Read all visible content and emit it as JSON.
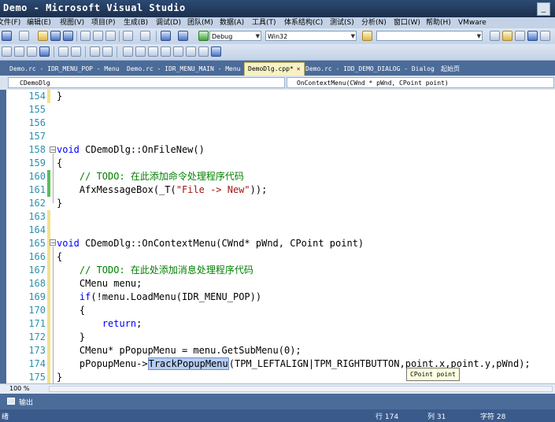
{
  "window": {
    "title": "Demo - Microsoft Visual Studio",
    "minimize_label": "_"
  },
  "menu": [
    "文件(F)",
    "编辑(E)",
    "视图(V)",
    "项目(P)",
    "生成(B)",
    "调试(D)",
    "团队(M)",
    "数据(A)",
    "工具(T)",
    "体系结构(C)",
    "测试(S)",
    "分析(N)",
    "窗口(W)",
    "帮助(H)",
    "VMware"
  ],
  "toolbar": {
    "config": "Debug",
    "platform": "Win32",
    "find": ""
  },
  "tabs": [
    {
      "label": "Demo.rc - IDR_MENU_POP - Menu",
      "active": false
    },
    {
      "label": "Demo.rc - IDR_MENU_MAIN - Menu",
      "active": false
    },
    {
      "label": "DemoDlg.cpp*",
      "active": true,
      "close": "×"
    },
    {
      "label": "Demo.rc - IDD_DEMO_DIALOG - Dialog",
      "active": false
    },
    {
      "label": "起始页",
      "active": false
    }
  ],
  "nav": {
    "class_combo": "CDemoDlg",
    "member_combo": "OnContextMenu(CWnd * pWnd, CPoint point)"
  },
  "editor": {
    "line_numbers": [
      "154",
      "155",
      "156",
      "157",
      "158",
      "159",
      "160",
      "161",
      "162",
      "163",
      "164",
      "165",
      "166",
      "167",
      "168",
      "169",
      "170",
      "171",
      "172",
      "173",
      "174",
      "175"
    ],
    "lines": {
      "l154": "}",
      "l158_kw": "void",
      "l158_rest": " CDemoDlg::OnFileNew()",
      "l159": "{",
      "l160": "    // TODO: 在此添加命令处理程序代码",
      "l161_a": "    AfxMessageBox(_T(",
      "l161_str": "\"File -> New\"",
      "l161_b": "));",
      "l162": "}",
      "l165_kw": "void",
      "l165_rest": " CDemoDlg::OnContextMenu(CWnd* pWnd, CPoint point)",
      "l166": "{",
      "l167": "    // TODO: 在此处添加消息处理程序代码",
      "l168": "    CMenu menu;",
      "l169_kw": "    if",
      "l169_rest": "(!menu.LoadMenu(IDR_MENU_POP))",
      "l170": "    {",
      "l171_kw": "        return",
      "l171_rest": ";",
      "l172": "    }",
      "l173": "    CMenu* pPopupMenu = menu.GetSubMenu(0);",
      "l174_a": "    pPopupMenu->",
      "l174_hl": "TrackPopupMenu",
      "l174_b": "(TPM_LEFTALIGN|TPM_RIGHTBUTTON,point.x,point.y,pWnd);",
      "l175": "}"
    },
    "tooltip": "CPoint point",
    "colors": {
      "keyword": "#0000ff",
      "comment": "#008000",
      "string": "#a31515",
      "line_number": "#2b91af"
    }
  },
  "zoom": "100 %",
  "output_panel": {
    "label": "输出"
  },
  "status": {
    "left": "绪",
    "line": "行 174",
    "col": "列 31",
    "char": "字符 28"
  }
}
